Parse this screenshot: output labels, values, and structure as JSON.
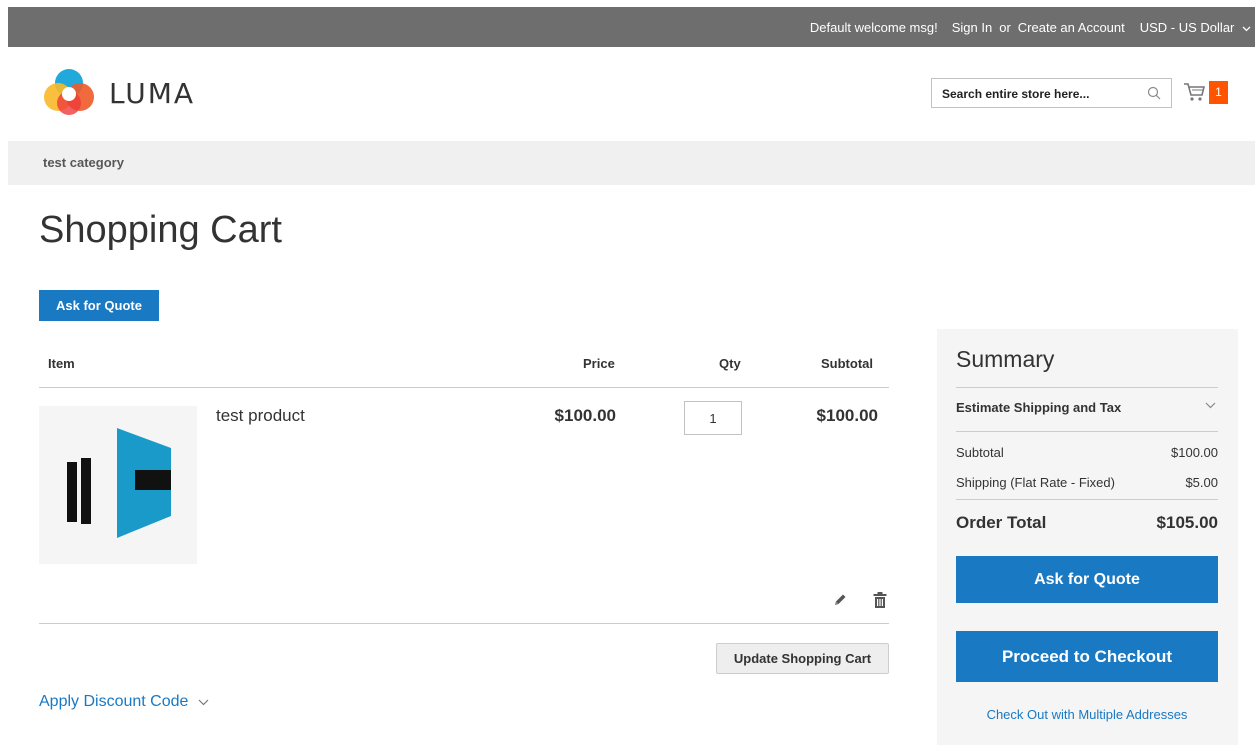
{
  "header_links": {
    "welcome": "Default welcome msg!",
    "sign_in": "Sign In",
    "or": "or",
    "create_account": "Create an Account",
    "currency": "USD - US Dollar"
  },
  "logo": {
    "text": "LUMA"
  },
  "search": {
    "placeholder": "Search entire store here..."
  },
  "minicart": {
    "count": "1"
  },
  "nav": {
    "items": [
      "test category"
    ]
  },
  "page": {
    "title": "Shopping Cart",
    "ask_quote_label": "Ask for Quote"
  },
  "cart": {
    "columns": [
      "Item",
      "Price",
      "Qty",
      "Subtotal"
    ],
    "items": [
      {
        "name": "test product",
        "price": "$100.00",
        "qty": "1",
        "subtotal": "$100.00"
      }
    ],
    "update_label": "Update Shopping Cart",
    "discount_label": "Apply Discount Code"
  },
  "summary": {
    "title": "Summary",
    "estimate_label": "Estimate Shipping and Tax",
    "rows": [
      {
        "label": "Subtotal",
        "value": "$100.00"
      },
      {
        "label": "Shipping (Flat Rate - Fixed)",
        "value": "$5.00"
      }
    ],
    "order_total_label": "Order Total",
    "order_total_value": "$105.00",
    "ask_quote_label": "Ask for Quote",
    "checkout_label": "Proceed to Checkout",
    "multi_address_label": "Check Out with Multiple Addresses"
  },
  "colors": {
    "accent": "#1979c3",
    "cart_badge": "#ff5501",
    "topbar": "#6e6e6e"
  },
  "icons": [
    "chevron-down-icon",
    "search-icon",
    "cart-icon",
    "edit-icon",
    "trash-icon"
  ]
}
